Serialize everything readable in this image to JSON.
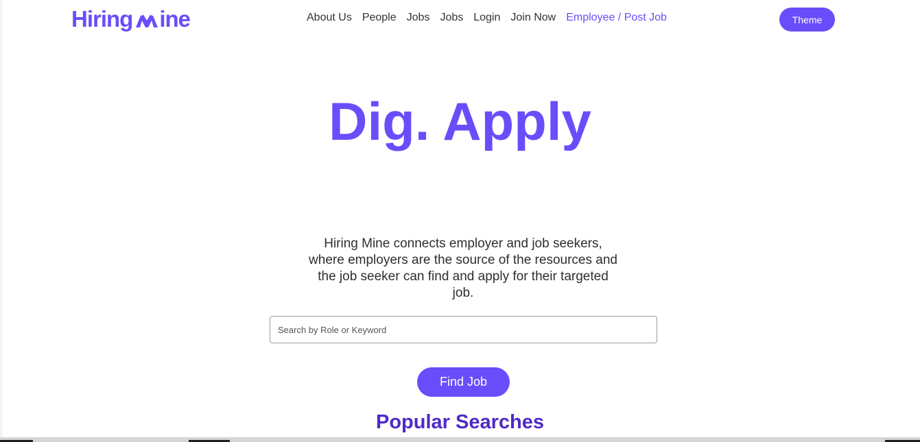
{
  "brand": {
    "logo_text_left": "Hiring",
    "logo_text_right": "ine",
    "logo_icon": "mountain-m-icon",
    "accent_color": "#6a4dfa"
  },
  "nav": {
    "items": [
      {
        "label": "About Us"
      },
      {
        "label": "People"
      },
      {
        "label": "Jobs"
      },
      {
        "label": "Jobs"
      },
      {
        "label": "Login"
      },
      {
        "label": "Join Now"
      },
      {
        "label": "Employee / Post Job"
      }
    ]
  },
  "header": {
    "theme_label": "Theme"
  },
  "hero": {
    "title": "Dig. Apply",
    "tagline": "Hiring Mine connects employer and job seekers, where employers are the source of the resources and the job seeker can find and apply for their targeted job."
  },
  "search": {
    "placeholder": "Search by Role or Keyword",
    "value": "",
    "button_label": "Find Job"
  },
  "popular": {
    "heading": "Popular Searches"
  }
}
